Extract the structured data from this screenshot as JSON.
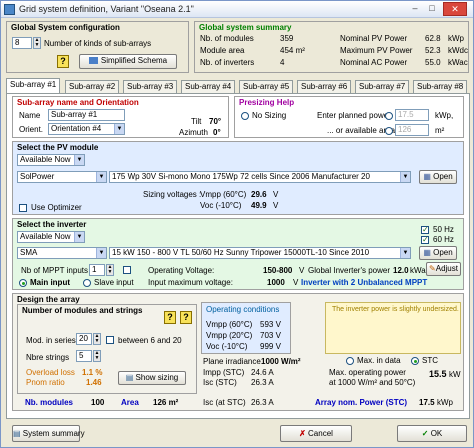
{
  "window": {
    "title": "Grid system definition, Variant \"Oseana 2.1\"",
    "min": "–",
    "max": "□",
    "close": "✕"
  },
  "global_config": {
    "header": "Global System configuration",
    "num_arrays_value": "8",
    "num_arrays_label": "Number of kinds of sub-arrays",
    "help": "?",
    "simplified_btn": "Simplified Schema"
  },
  "global_summary": {
    "header": "Global system summary",
    "rows": [
      {
        "l1": "Nb. of modules",
        "v1": "359",
        "l2": "Nominal PV Power",
        "v2": "62.8",
        "u2": "kWp"
      },
      {
        "l1": "Module area",
        "v1": "454 m²",
        "l2": "Maximum PV Power",
        "v2": "52.3",
        "u2": "kWdc"
      },
      {
        "l1": "Nb. of inverters",
        "v1": "4",
        "l2": "Nominal AC Power",
        "v2": "55.0",
        "u2": "kWac"
      }
    ]
  },
  "tabs": [
    "Sub-array #1",
    "Sub-array #2",
    "Sub-array #3",
    "Sub-array #4",
    "Sub-array #5",
    "Sub-array #6",
    "Sub-array #7",
    "Sub-array #8"
  ],
  "subarray_name": {
    "header": "Sub-array name and Orientation",
    "name_label": "Name",
    "name_value": "Sub-array #1",
    "orient_label": "Orient.",
    "orient_value": "Orientation #4",
    "tilt_label": "Tilt",
    "tilt_value": "70°",
    "azimuth_label": "Azimuth",
    "azimuth_value": "0°"
  },
  "presizing": {
    "header": "Presizing Help",
    "no_sizing": "No Sizing",
    "planned_power_label": "Enter planned power",
    "planned_power_value": "17.5",
    "planned_power_unit": "kWp,",
    "area_label": "... or available area",
    "area_value": "126",
    "area_unit": "m²"
  },
  "pv_module": {
    "header": "Select the PV module",
    "filter": "Available Now",
    "manufacturer": "SolPower",
    "model": "175 Wp 30V    Si-mono   Mono 175Wp 72 cells    Since 2006         Manufacturer 20",
    "open_btn": "Open",
    "sizing_label": "Sizing voltages :",
    "vmpp_label": "Vmpp (60°C)",
    "vmpp_value": "29.6",
    "vmpp_unit": "V",
    "voc_label": "Voc (-10°C)",
    "voc_value": "49.9",
    "voc_unit": "V",
    "use_optimizer": "Use Optimizer"
  },
  "inverter": {
    "header": "Select the inverter",
    "filter": "Available Now",
    "manufacturer": "SMA",
    "model": "15 kW    150 - 800 V  TL      50/60 Hz   Sunny Tripower 15000TL-10               Since 2010",
    "hz50": "50 Hz",
    "hz60": "60 Hz",
    "open_btn": "Open",
    "mppt_label": "Nb of MPPT inputs",
    "mppt_value": "1",
    "op_voltage_label": "Operating Voltage:",
    "op_voltage_value": "150-800",
    "op_voltage_unit": "V",
    "max_voltage_label": "Input maximum voltage:",
    "max_voltage_value": "1000",
    "max_voltage_unit": "V",
    "global_power_label": "Global Inverter's power",
    "global_power_value": "12.0",
    "global_power_unit": "kWac",
    "adjust_btn": "Adjust",
    "main_input": "Main input",
    "slave_input": "Slave input",
    "unbalanced_msg": "Inverter with  2 Unbalanced MPPT"
  },
  "design": {
    "header": "Design the array",
    "sub_header": "Number of modules and strings",
    "series_label": "Mod. in series",
    "series_value": "20",
    "between_label": "between 6 and 20",
    "strings_label": "Nbre strings",
    "strings_value": "5",
    "overload_label": "Overload loss",
    "overload_value": "1.1 %",
    "pnom_label": "Pnom ratio",
    "pnom_value": "1.46",
    "show_sizing_btn": "Show sizing",
    "nb_modules_label": "Nb. modules",
    "nb_modules_value": "100",
    "area_label": "Area",
    "area_value": "126 m²",
    "op_cond_header": "Operating conditions",
    "vmpp60_label": "Vmpp (60°C)",
    "vmpp60_value": "593 V",
    "vmpp20_label": "Vmpp (20°C)",
    "vmpp20_value": "703 V",
    "voc10_label": "Voc (-10°C)",
    "voc10_value": "999 V",
    "irr_label": "Plane irradiance",
    "irr_value": "1000 W/m²",
    "impp_label": "Impp (STC)",
    "impp_value": "24.6 A",
    "isc_label": "Isc (STC)",
    "isc_value": "26.3 A",
    "isc_at_label": "Isc (at STC)",
    "isc_at_value": "26.3 A",
    "max_data": "Max. in data",
    "stc": "STC",
    "max_op_label1": "Max. operating power",
    "max_op_label2": "at 1000 W/m² and 50°C)",
    "max_op_value": "15.5",
    "max_op_unit": "kW",
    "array_power_label": "Array nom. Power (STC)",
    "array_power_value": "17.5",
    "array_power_unit": "kWp",
    "warning": "The inverter power is slightly undersized."
  },
  "footer": {
    "summary_btn": "System summary",
    "cancel_btn": "Cancel",
    "ok_btn": "OK"
  }
}
